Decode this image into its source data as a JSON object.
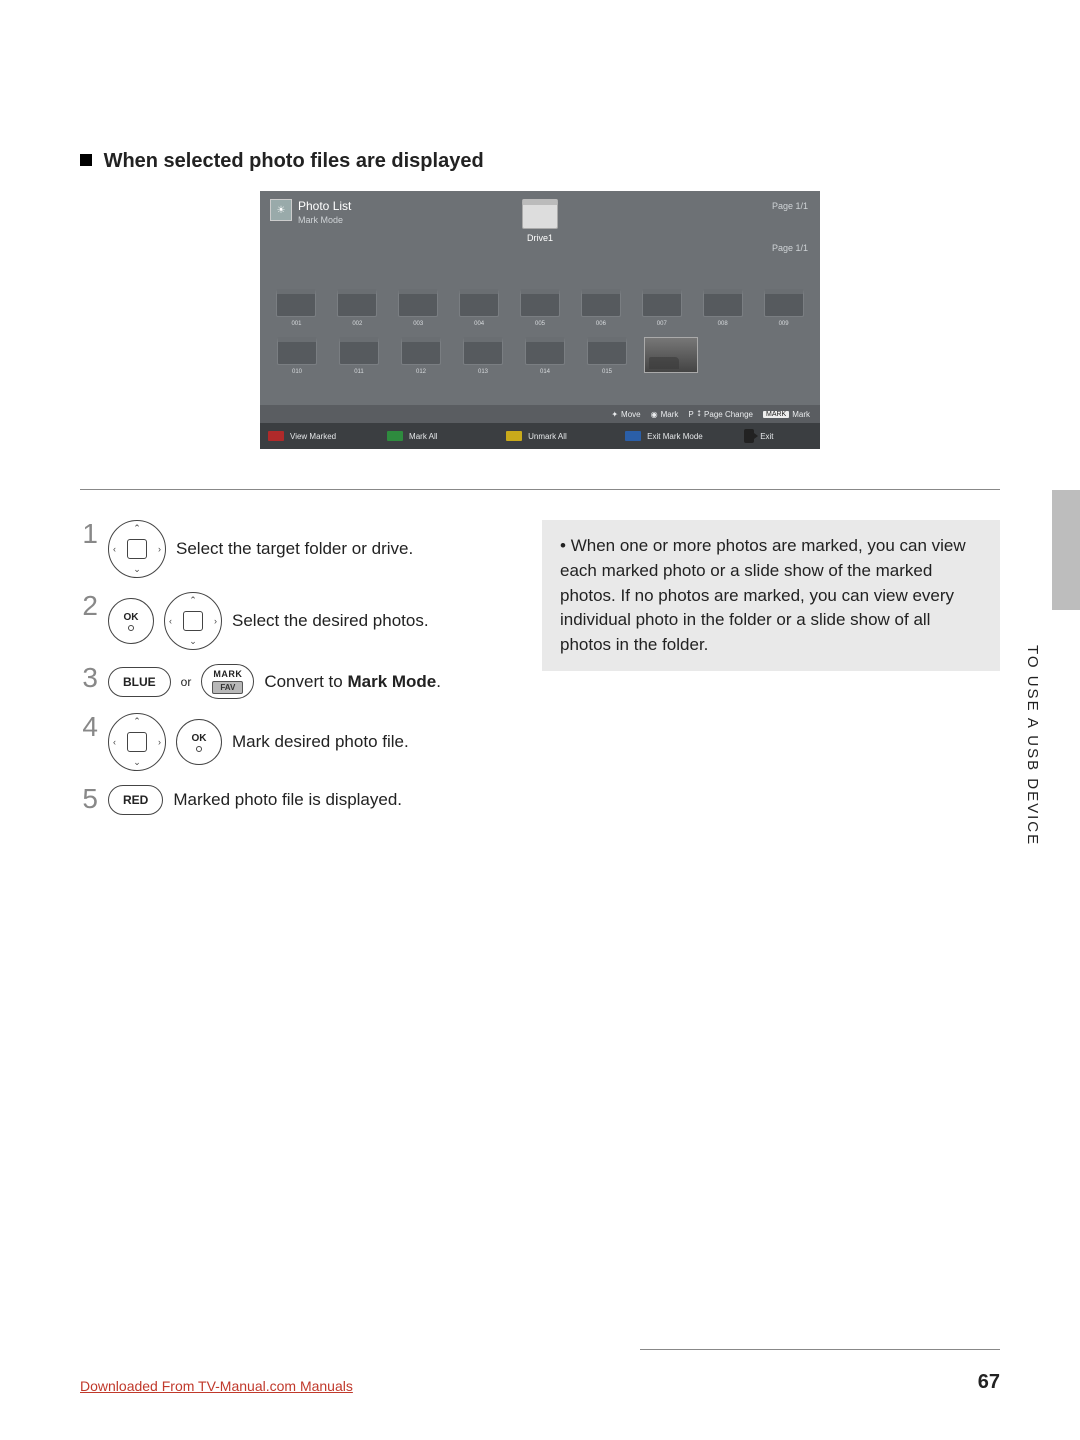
{
  "heading": "When selected photo files are displayed",
  "tv": {
    "title": "Photo List",
    "subtitle": "Mark Mode",
    "drive_label": "Drive1",
    "page_top": "Page 1/1",
    "page_mid": "Page 1/1",
    "folders_row1": [
      "001",
      "002",
      "003",
      "004",
      "005",
      "006",
      "007",
      "008",
      "009"
    ],
    "folders_row2": [
      "010",
      "011",
      "012",
      "013",
      "014",
      "015"
    ],
    "help": {
      "move": "Move",
      "mark": "Mark",
      "page_change_prefix": "P",
      "page_change": "Page Change",
      "mark_badge": "MARK",
      "mark_label": "Mark"
    },
    "buttons": {
      "red": "View Marked",
      "green": "Mark All",
      "yellow": "Unmark All",
      "blue": "Exit Mark Mode",
      "exit": "Exit"
    }
  },
  "steps": {
    "s1": "Select the target folder or drive.",
    "s2": "Select the desired photos.",
    "s3_blue": "BLUE",
    "s3_or": "or",
    "s3_mark": "MARK",
    "s3_fav": "FAV",
    "s3_pre": "Convert to ",
    "s3_bold": "Mark Mode",
    "s3_post": ".",
    "s4": "Mark desired photo file.",
    "s5_red": "RED",
    "s5": "Marked photo file is displayed.",
    "ok_label": "OK"
  },
  "note": "When one or more photos are marked, you can view each marked photo or a slide show of the marked photos. If no photos are marked, you can view every individual photo in the folder or a slide show of all photos in the folder.",
  "side_tab": "TO USE A USB DEVICE",
  "footer_link": "Downloaded From TV-Manual.com Manuals",
  "page_number": "67"
}
